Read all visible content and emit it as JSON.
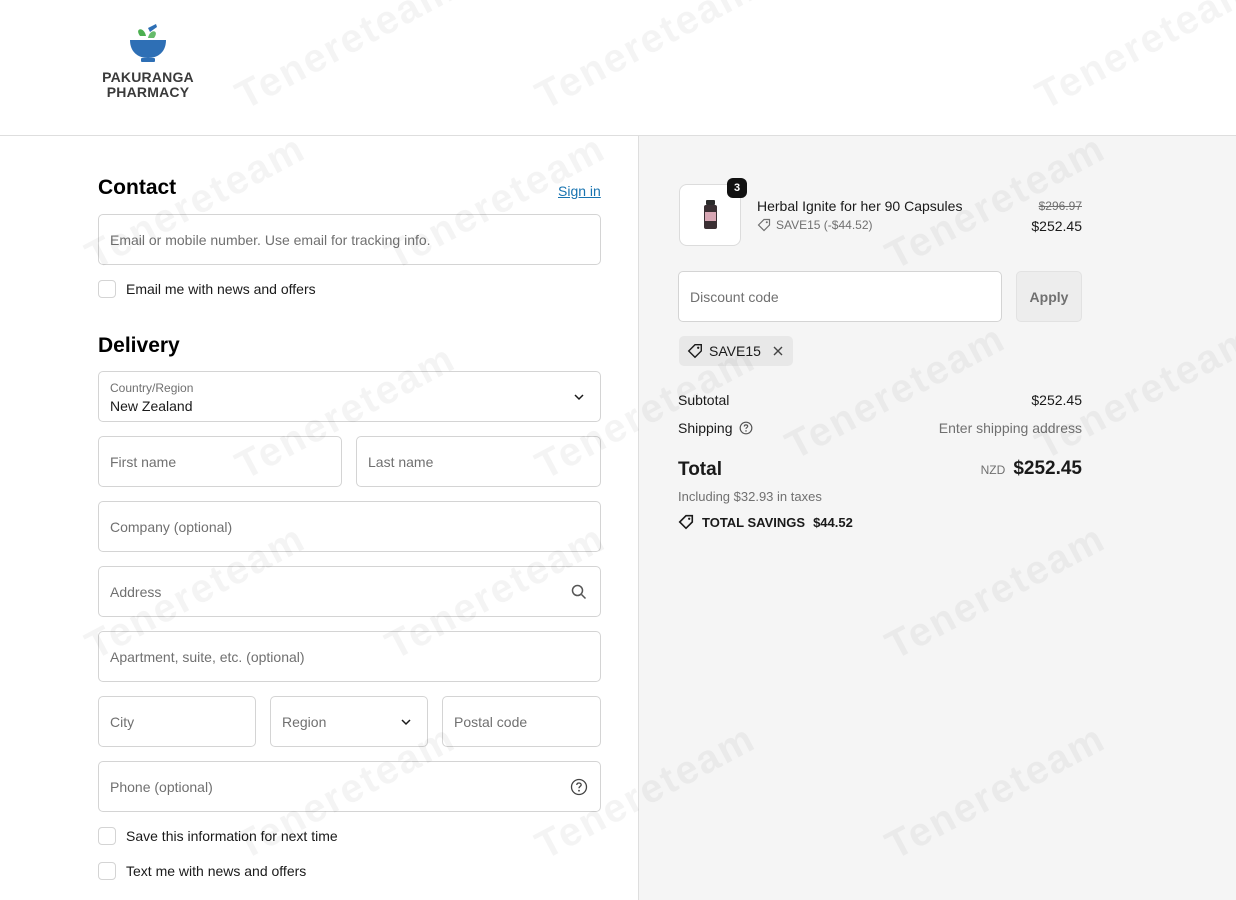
{
  "brand": {
    "line1": "PAKURANGA",
    "line2": "PHARMACY"
  },
  "watermark": "Tenereteam",
  "contact": {
    "heading": "Contact",
    "sign_in": "Sign in",
    "email_placeholder": "Email or mobile number. Use email for tracking info.",
    "newsletter_label": "Email me with news and offers"
  },
  "delivery": {
    "heading": "Delivery",
    "country_label": "Country/Region",
    "country_value": "New Zealand",
    "first_name": "First name",
    "last_name": "Last name",
    "company": "Company (optional)",
    "address": "Address",
    "apartment": "Apartment, suite, etc. (optional)",
    "city": "City",
    "region": "Region",
    "postal": "Postal code",
    "phone": "Phone (optional)",
    "save_info": "Save this information for next time",
    "text_offers": "Text me with news and offers"
  },
  "order": {
    "item_name": "Herbal Ignite for her 90 Capsules",
    "quantity": "3",
    "item_discount": "SAVE15 (-$44.52)",
    "original_price": "$296.97",
    "price": "$252.45",
    "discount_placeholder": "Discount code",
    "apply_label": "Apply",
    "applied_code": "SAVE15",
    "subtotal_label": "Subtotal",
    "subtotal_value": "$252.45",
    "shipping_label": "Shipping",
    "shipping_value": "Enter shipping address",
    "total_label": "Total",
    "currency": "NZD",
    "total_value": "$252.45",
    "tax_note": "Including $32.93 in taxes",
    "savings_label": "TOTAL SAVINGS",
    "savings_value": "$44.52"
  }
}
